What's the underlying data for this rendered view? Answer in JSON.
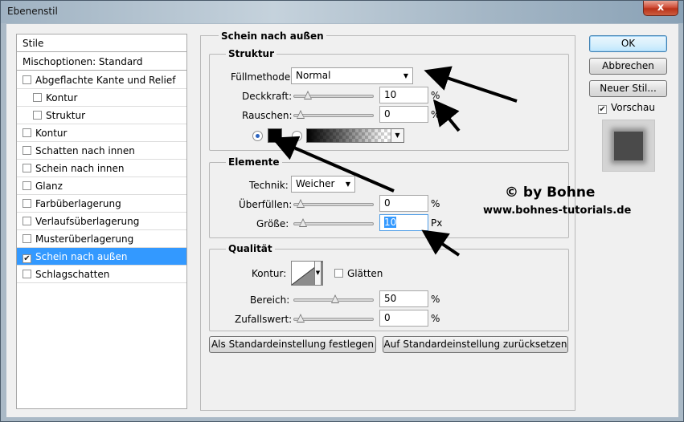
{
  "window": {
    "title": "Ebenenstil",
    "close_label": "x"
  },
  "styles_list": {
    "header": "Stile",
    "blend_options": "Mischoptionen: Standard",
    "items": [
      {
        "label": "Abgeflachte Kante und Relief",
        "checked": false,
        "sub": false
      },
      {
        "label": "Kontur",
        "checked": false,
        "sub": true
      },
      {
        "label": "Struktur",
        "checked": false,
        "sub": true
      },
      {
        "label": "Kontur",
        "checked": false,
        "sub": false
      },
      {
        "label": "Schatten nach innen",
        "checked": false,
        "sub": false
      },
      {
        "label": "Schein nach innen",
        "checked": false,
        "sub": false
      },
      {
        "label": "Glanz",
        "checked": false,
        "sub": false
      },
      {
        "label": "Farbüberlagerung",
        "checked": false,
        "sub": false
      },
      {
        "label": "Verlaufsüberlagerung",
        "checked": false,
        "sub": false
      },
      {
        "label": "Musterüberlagerung",
        "checked": false,
        "sub": false
      },
      {
        "label": "Schein nach außen",
        "checked": true,
        "sub": false,
        "selected": true
      },
      {
        "label": "Schlagschatten",
        "checked": false,
        "sub": false
      }
    ]
  },
  "panel": {
    "title": "Schein nach außen",
    "structure": {
      "title": "Struktur",
      "blend_mode_label": "Füllmethode:",
      "blend_mode_value": "Normal",
      "opacity_label": "Deckkraft:",
      "opacity_value": "10",
      "opacity_fraction": 0.1,
      "opacity_unit": "%",
      "noise_label": "Rauschen:",
      "noise_value": "0",
      "noise_fraction": 0.0,
      "noise_unit": "%",
      "color_swatch": "#000000"
    },
    "elements": {
      "title": "Elemente",
      "technique_label": "Technik:",
      "technique_value": "Weicher",
      "spread_label": "Überfüllen:",
      "spread_value": "0",
      "spread_fraction": 0.0,
      "spread_unit": "%",
      "size_label": "Größe:",
      "size_value": "10",
      "size_fraction": 0.04,
      "size_unit": "Px"
    },
    "quality": {
      "title": "Qualität",
      "contour_label": "Kontur:",
      "antialias_label": "Glätten",
      "antialias_checked": false,
      "range_label": "Bereich:",
      "range_value": "50",
      "range_fraction": 0.5,
      "range_unit": "%",
      "jitter_label": "Zufallswert:",
      "jitter_value": "0",
      "jitter_fraction": 0.0,
      "jitter_unit": "%"
    },
    "make_default_label": "Als Standardeinstellung festlegen",
    "reset_default_label": "Auf Standardeinstellung zurücksetzen"
  },
  "buttons": {
    "ok": "OK",
    "cancel": "Abbrechen",
    "new_style": "Neuer Stil...",
    "preview_label": "Vorschau",
    "preview_checked": true
  },
  "watermark": {
    "line1": "© by Bohne",
    "line2": "www.bohnes-tutorials.de"
  }
}
